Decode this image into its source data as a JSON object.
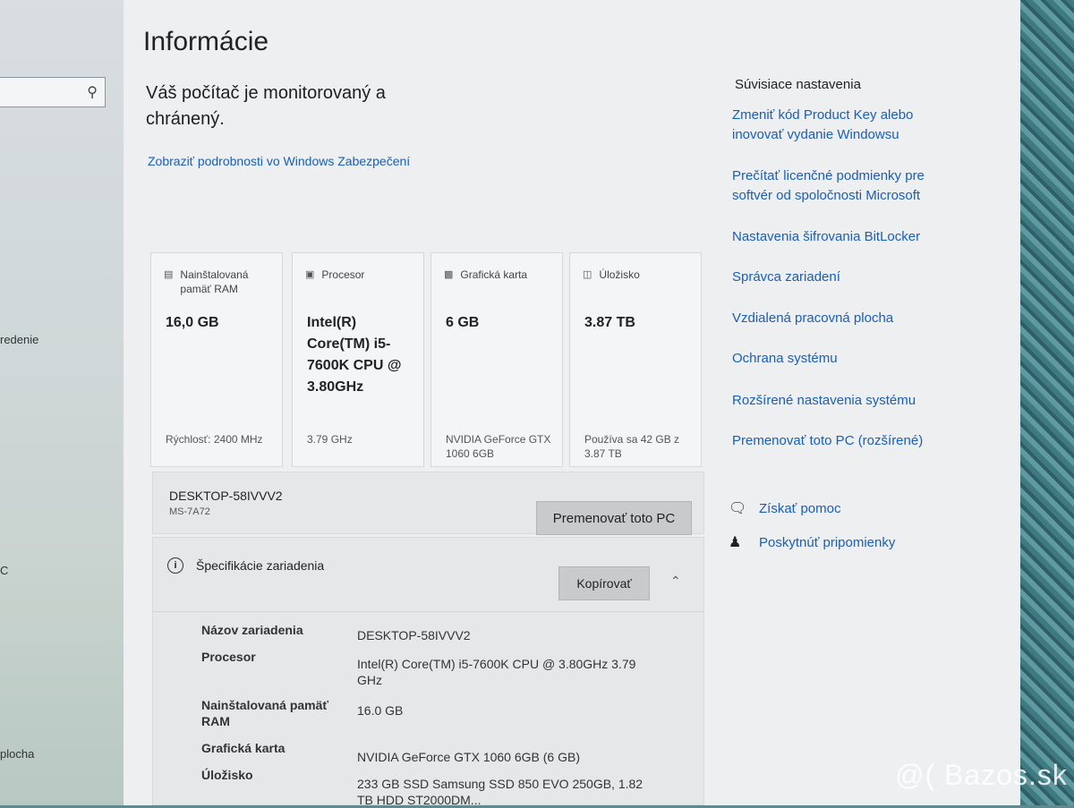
{
  "title": "Informácie",
  "security": {
    "status": "Váš počítač je monitorovaný a chránený.",
    "link": "Zobraziť podrobnosti vo Windows Zabezpečení"
  },
  "sidebar": {
    "search_icon": "search-icon",
    "fragments": [
      "redenie",
      "C",
      "plocha"
    ]
  },
  "cards": [
    {
      "icon": "ram-icon",
      "title": "Nainštalovaná pamäť RAM",
      "value": "16,0 GB",
      "sub": "Rýchlosť: 2400 MHz"
    },
    {
      "icon": "cpu-icon",
      "title": "Procesor",
      "value": "Intel(R) Core(TM) i5-7600K CPU @ 3.80GHz",
      "sub": "3.79 GHz"
    },
    {
      "icon": "gpu-icon",
      "title": "Grafická karta",
      "value": "6 GB",
      "sub": "NVIDIA GeForce GTX 1060 6GB"
    },
    {
      "icon": "storage-icon",
      "title": "Úložisko",
      "value": "3.87 TB",
      "sub": "Používa sa 42 GB z 3.87 TB"
    }
  ],
  "device": {
    "name": "DESKTOP-58IVVV2",
    "model": "MS-7A72",
    "rename_label": "Premenovať toto PC"
  },
  "specs": {
    "heading": "Špecifikácie zariadenia",
    "copy_label": "Kopírovať",
    "rows": [
      {
        "label": "Názov zariadenia",
        "value": "DESKTOP-58IVVV2"
      },
      {
        "label": "Procesor",
        "value": "Intel(R) Core(TM) i5-7600K CPU @ 3.80GHz 3.79 GHz"
      },
      {
        "label": "Nainštalovaná pamäť RAM",
        "value": "16.0 GB"
      },
      {
        "label": "Grafická karta",
        "value": "NVIDIA GeForce GTX 1060 6GB (6 GB)"
      },
      {
        "label": "Úložisko",
        "value": "233 GB SSD Samsung SSD 850 EVO 250GB, 1.82 TB HDD ST2000DM..."
      }
    ]
  },
  "related": {
    "heading": "Súvisiace nastavenia",
    "links": [
      "Zmeniť kód Product Key alebo inovovať vydanie Windowsu",
      "Prečítať licenčné podmienky pre softvér od spoločnosti Microsoft",
      "Nastavenia šifrovania BitLocker",
      "Správca zariadení",
      "Vzdialená pracovná plocha",
      "Ochrana systému",
      "Rozšírené nastavenia systému",
      "Premenovať toto PC (rozšírené)"
    ]
  },
  "help": {
    "get_help": "Získať pomoc",
    "feedback": "Poskytnúť pripomienky"
  },
  "watermark": "@( Bazos.sk",
  "colors": {
    "link": "#1a5fb4",
    "window_bg": "#eeeff1",
    "card_bg": "#f4f5f6",
    "button_bg": "#c9cacc"
  }
}
